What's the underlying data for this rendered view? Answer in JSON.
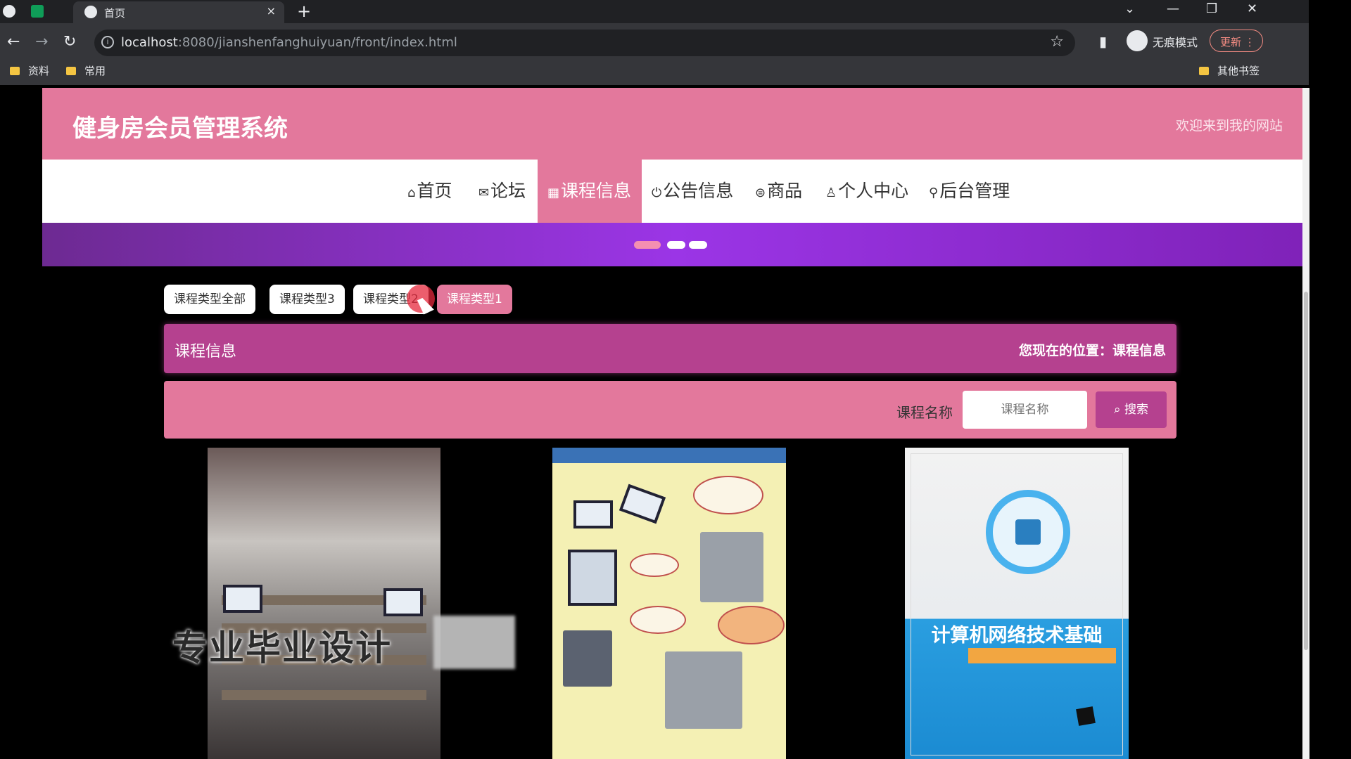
{
  "browser": {
    "tab_title": "首页",
    "tab_close": "×",
    "new_tab": "+",
    "url_host": "localhost",
    "url_rest": ":8080/jianshenfanghuiyuan/front/index.html",
    "incognito_label": "无痕模式",
    "update_label": "更新",
    "bookmarks": [
      "资料",
      "常用"
    ],
    "other_bookmarks": "其他书签"
  },
  "header": {
    "site_title": "健身房会员管理系统",
    "welcome": "欢迎来到我的网站",
    "brand_color": "#e3789c",
    "accent_color": "#b5418f"
  },
  "nav": {
    "items": [
      {
        "icon": "⌂",
        "label": "首页"
      },
      {
        "icon": "✉",
        "label": "论坛"
      },
      {
        "icon": "▦",
        "label": "课程信息"
      },
      {
        "icon": "⏻",
        "label": "公告信息"
      },
      {
        "icon": "⊜",
        "label": "商品"
      },
      {
        "icon": "♙",
        "label": "个人中心"
      },
      {
        "icon": "⚲",
        "label": "后台管理"
      }
    ],
    "active": "课程信息"
  },
  "filters": {
    "items": [
      "课程类型全部",
      "课程类型3",
      "课程类型2",
      "课程类型1"
    ],
    "active": "课程类型1"
  },
  "section": {
    "title": "课程信息",
    "location": "您现在的位置：课程信息"
  },
  "search": {
    "label": "课程名称",
    "placeholder": "课程名称",
    "button": "搜索"
  },
  "book": {
    "title": "计算机网络技术基础"
  },
  "watermark": "专业毕业设计"
}
